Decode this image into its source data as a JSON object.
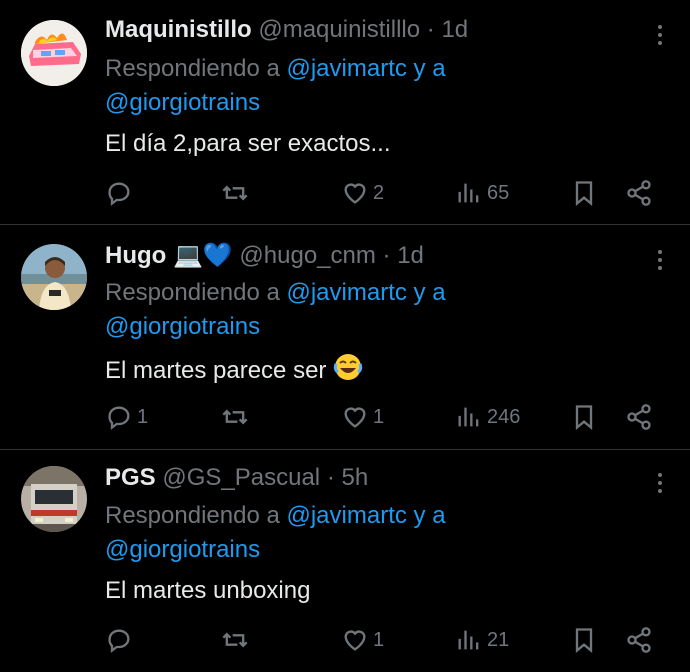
{
  "tweets": [
    {
      "name": "Maquinistillo",
      "name_emoji": "",
      "handle": "@maquinistilllo",
      "time": "· 1d",
      "reply_prefix": "Respondiendo a",
      "reply_user1": "@javimartc",
      "reply_and": "y a",
      "reply_user2": "@giorgiotrains",
      "text": "El día 2,para ser exactos...",
      "replies": "",
      "likes": "2",
      "views": "65"
    },
    {
      "name": "Hugo",
      "name_emoji": "💻💙",
      "handle": "@hugo_cnm",
      "time": "· 1d",
      "reply_prefix": "Respondiendo a",
      "reply_user1": "@javimartc",
      "reply_and": "y a",
      "reply_user2": "@giorgiotrains",
      "text": "El martes parece ser",
      "replies": "1",
      "likes": "1",
      "views": "246"
    },
    {
      "name": "PGS",
      "name_emoji": "",
      "handle": "@GS_Pascual",
      "time": "· 5h",
      "reply_prefix": "Respondiendo a",
      "reply_user1": "@javimartc",
      "reply_and": "y a",
      "reply_user2": "@giorgiotrains",
      "text": "El martes unboxing",
      "replies": "",
      "likes": "1",
      "views": "21"
    }
  ],
  "icons": [
    "reply-icon",
    "retweet-icon",
    "like-icon",
    "views-icon",
    "bookmark-icon",
    "share-icon",
    "more-icon",
    "laughing-emoji-icon"
  ],
  "colors": {
    "background": "#000000",
    "text": "#e7e9ea",
    "muted": "#71767b",
    "link": "#1d9bf0",
    "separator": "#2f3336"
  }
}
